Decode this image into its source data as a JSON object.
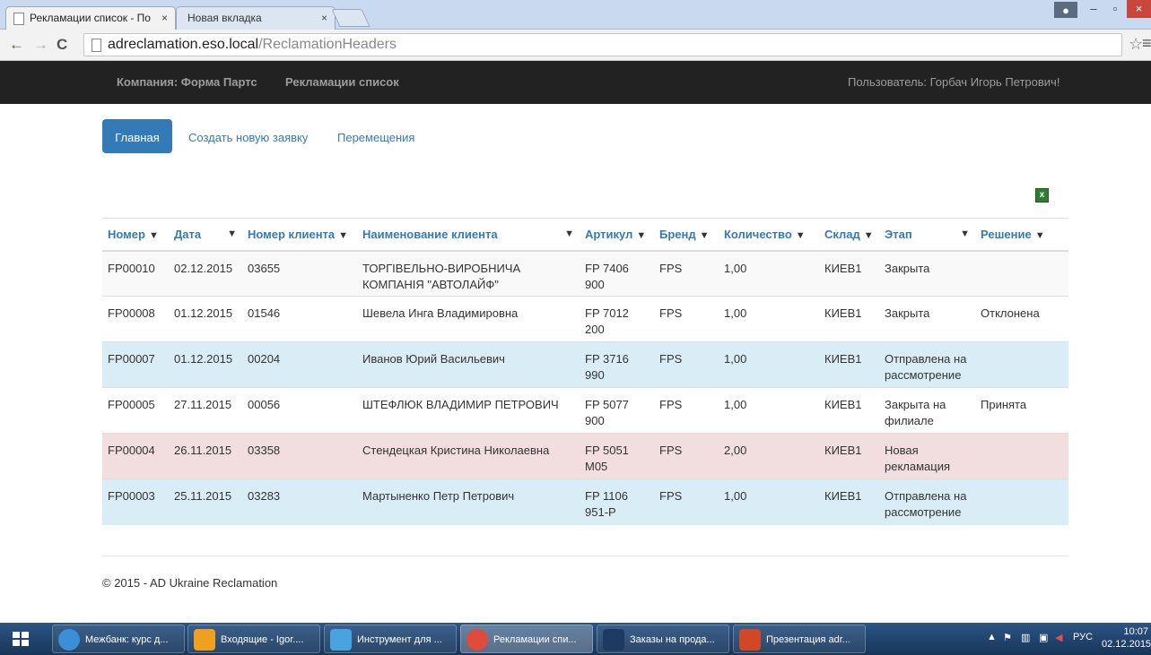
{
  "browser": {
    "tabs": [
      {
        "label": "Рекламации список - По"
      },
      {
        "label": "Новая вкладка"
      }
    ],
    "url_host": "adreclamation.eso.local",
    "url_path": "/ReclamationHeaders"
  },
  "navbar": {
    "company": "Компания: Форма Партс",
    "link": "Рекламации список",
    "user": "Пользователь: Горбач Игорь Петрович!"
  },
  "pills": {
    "home": "Главная",
    "create": "Создать новую заявку",
    "moves": "Перемещения"
  },
  "table": {
    "headers": [
      "Номер",
      "Дата",
      "Номер клиента",
      "Наименование клиента",
      "Артикул",
      "Бренд",
      "Количество",
      "Склад",
      "Этап",
      "Решение"
    ],
    "rows": [
      {
        "number": "FP00010",
        "date": "02.12.2015",
        "client_no": "03655",
        "client_name_1": "ТОРГІВЕЛЬНО-ВИРОБНИЧА",
        "client_name_2": "КОМПАНІЯ \"АВТОЛАЙФ\"",
        "article_1": "FP 7406",
        "article_2": "900",
        "brand": "FPS",
        "qty": "1,00",
        "warehouse": "КИЕВ1",
        "stage_1": "Закрыта",
        "stage_2": "",
        "decision": "",
        "style": "default"
      },
      {
        "number": "FP00008",
        "date": "01.12.2015",
        "client_no": "01546",
        "client_name_1": "Шевела Инга Владимировна",
        "client_name_2": "",
        "article_1": "FP 7012",
        "article_2": "200",
        "brand": "FPS",
        "qty": "1,00",
        "warehouse": "КИЕВ1",
        "stage_1": "Закрыта",
        "stage_2": "",
        "decision": "Отклонена",
        "style": "plain"
      },
      {
        "number": "FP00007",
        "date": "01.12.2015",
        "client_no": "00204",
        "client_name_1": "Иванов Юрий Васильевич",
        "client_name_2": "",
        "article_1": "FP 3716",
        "article_2": "990",
        "brand": "FPS",
        "qty": "1,00",
        "warehouse": "КИЕВ1",
        "stage_1": "Отправлена на",
        "stage_2": "рассмотрение",
        "decision": "",
        "style": "info"
      },
      {
        "number": "FP00005",
        "date": "27.11.2015",
        "client_no": "00056",
        "client_name_1": "ШТЕФЛЮК ВЛАДИМИР ПЕТРОВИЧ",
        "client_name_2": "",
        "article_1": "FP 5077",
        "article_2": "900",
        "brand": "FPS",
        "qty": "1,00",
        "warehouse": "КИЕВ1",
        "stage_1": "Закрыта на",
        "stage_2": "филиале",
        "decision": "Принята",
        "style": "plain"
      },
      {
        "number": "FP00004",
        "date": "26.11.2015",
        "client_no": "03358",
        "client_name_1": "Стендецкая Кристина Николаевна",
        "client_name_2": "",
        "article_1": "FP 5051",
        "article_2": "M05",
        "brand": "FPS",
        "qty": "2,00",
        "warehouse": "КИЕВ1",
        "stage_1": "Новая",
        "stage_2": "рекламация",
        "decision": "",
        "style": "danger"
      },
      {
        "number": "FP00003",
        "date": "25.11.2015",
        "client_no": "03283",
        "client_name_1": "Мартыненко Петр Петрович",
        "client_name_2": "",
        "article_1": "FP 1106",
        "article_2": "951-P",
        "brand": "FPS",
        "qty": "1,00",
        "warehouse": "КИЕВ1",
        "stage_1": "Отправлена на",
        "stage_2": "рассмотрение",
        "decision": "",
        "style": "info"
      }
    ]
  },
  "footer": "© 2015 - AD Ukraine Reclamation",
  "taskbar": {
    "tasks": [
      {
        "label": "Межбанк: курс д..."
      },
      {
        "label": "Входящие - Igor...."
      },
      {
        "label": "Инструмент для ..."
      },
      {
        "label": "Рекламации спи..."
      },
      {
        "label": "Заказы на прода..."
      },
      {
        "label": "Презентация adr..."
      }
    ],
    "lang": "РУС",
    "time": "10:07",
    "date": "02.12.2015"
  },
  "colors": {
    "navbar": "#222222",
    "primary": "#337ab7",
    "row_info": "#d9edf7",
    "row_danger": "#f2dede"
  },
  "icons": {
    "filter": "filter-icon",
    "excel": "excel-export-icon"
  }
}
